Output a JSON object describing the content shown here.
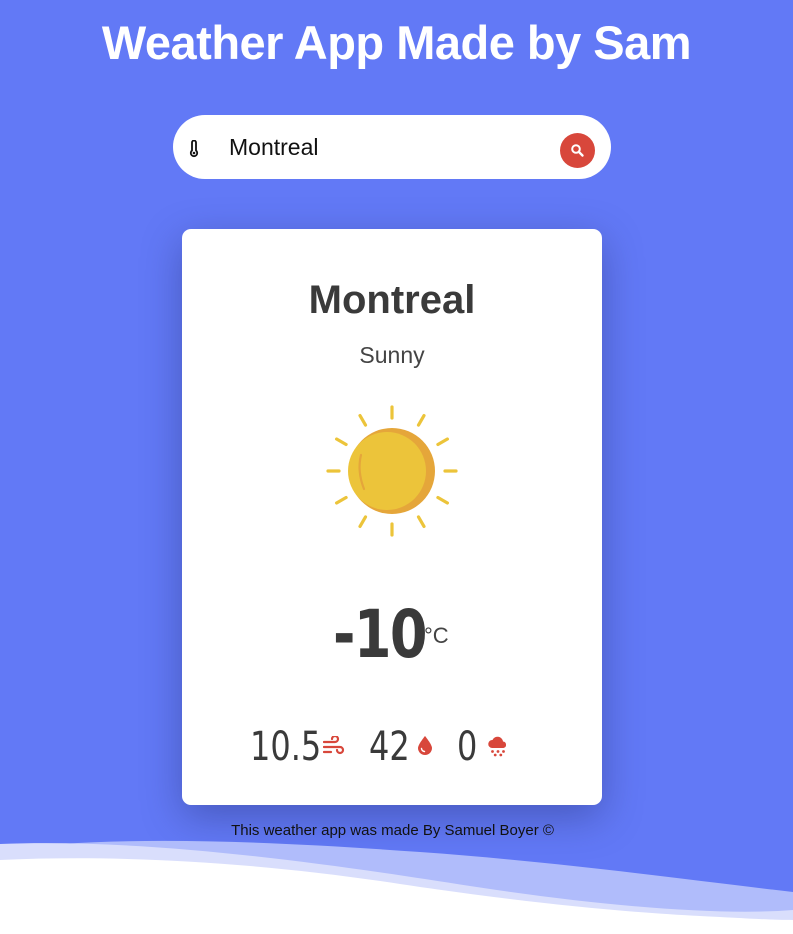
{
  "header": {
    "title": "Weather App Made by Sam"
  },
  "search": {
    "value": "Montreal",
    "icon": "thermometer-icon",
    "button_icon": "search-icon"
  },
  "weather": {
    "city": "Montreal",
    "condition": "Sunny",
    "icon": "sun-icon",
    "temperature": "-10",
    "unit": "°C",
    "wind": "10.5",
    "wind_icon": "wind-icon",
    "humidity": "42",
    "humidity_icon": "droplet-icon",
    "precipitation": "0",
    "precipitation_icon": "rain-cloud-icon"
  },
  "footer": {
    "text": "This weather app was made By Samuel Boyer ©"
  },
  "colors": {
    "background": "#6279f6",
    "accent": "#d8473b",
    "sun": "#ecc43a",
    "text_dark": "#3a3a3a"
  }
}
